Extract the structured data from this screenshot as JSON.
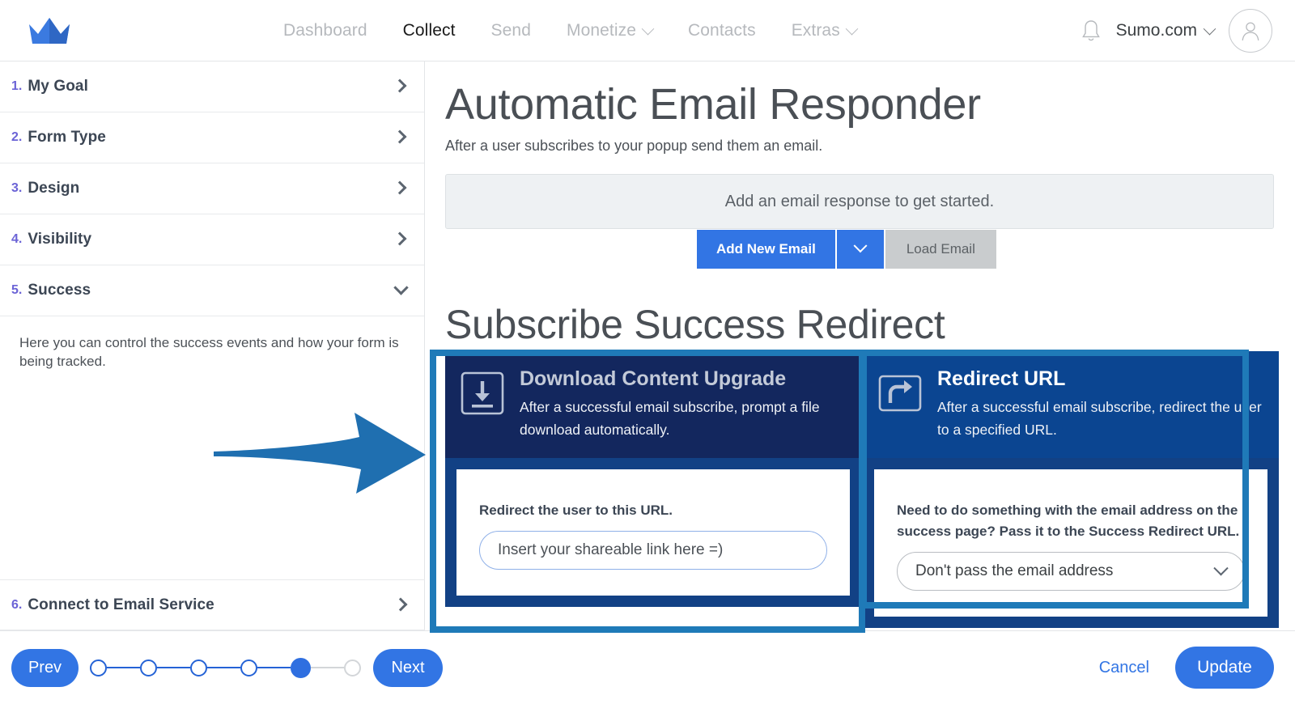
{
  "nav": {
    "logo": "crown-logo",
    "links": [
      {
        "label": "Dashboard",
        "active": false,
        "caret": false
      },
      {
        "label": "Collect",
        "active": true,
        "caret": false
      },
      {
        "label": "Send",
        "active": false,
        "caret": false
      },
      {
        "label": "Monetize",
        "active": false,
        "caret": true
      },
      {
        "label": "Contacts",
        "active": false,
        "caret": false
      },
      {
        "label": "Extras",
        "active": false,
        "caret": true
      }
    ],
    "notification_icon": "bell-icon",
    "account_label": "Sumo.com",
    "avatar_icon": "user-avatar-icon"
  },
  "sidebar": {
    "steps": [
      {
        "num": "1.",
        "label": "My Goal",
        "state": "collapsed"
      },
      {
        "num": "2.",
        "label": "Form Type",
        "state": "collapsed"
      },
      {
        "num": "3.",
        "label": "Design",
        "state": "collapsed"
      },
      {
        "num": "4.",
        "label": "Visibility",
        "state": "collapsed"
      },
      {
        "num": "5.",
        "label": "Success",
        "state": "expanded"
      },
      {
        "num": "6.",
        "label": "Connect to Email Service",
        "state": "collapsed"
      }
    ],
    "success_description": "Here you can control the success events and how your form is being tracked."
  },
  "main": {
    "title": "Automatic Email Responder",
    "subtitle": "After a user subscribes to your popup send them an email.",
    "empty_state": "Add an email response to get started.",
    "add_new_email": "Add New Email",
    "add_new_email_caret": "chevron-down-icon",
    "load_email": "Load Email",
    "section_title": "Subscribe Success Redirect",
    "cards": [
      {
        "id": "download-content-upgrade",
        "icon": "download-icon",
        "title": "Download Content Upgrade",
        "description": "After a successful email subscribe, prompt a file download automatically.",
        "field_label": "Redirect the user to this URL.",
        "input_placeholder": "Insert your shareable link here =)",
        "input_value": "",
        "bg": "#13275e"
      },
      {
        "id": "redirect-url",
        "icon": "redirect-arrow-icon",
        "title": "Redirect URL",
        "description": "After a successful email subscribe, redirect the user to a specified URL.",
        "field_label": "Need to do something with the email address on the success page? Pass it to the Success Redirect URL.",
        "select_value": "Don't pass the email address",
        "select_caret": "chevron-down-icon",
        "bg": "#0b4591"
      }
    ]
  },
  "footer": {
    "prev": "Prev",
    "next": "Next",
    "cancel": "Cancel",
    "update": "Update",
    "total_steps": 6,
    "current_step": 5
  },
  "annotations": {
    "arrow": {
      "name": "pointer-arrow",
      "color": "#1f6fb0"
    },
    "highlight_color": "#1f7ab8",
    "highlight_boxes": 2
  },
  "colors": {
    "accent_blue": "#3275e4",
    "step_num_purple": "#6b63d6",
    "card_dark_navy": "#13275e",
    "card_blue": "#0b4591",
    "card_border_blue": "#124185",
    "annotation_blue": "#1f7ab8"
  }
}
